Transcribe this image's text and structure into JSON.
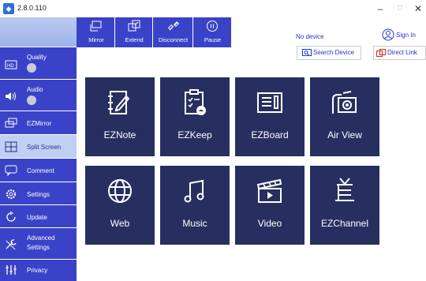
{
  "window": {
    "version": "2.8.0.110",
    "minimize": "–",
    "maximize": "□",
    "close": "✕"
  },
  "toolbar": {
    "mirror": "Mirror",
    "extend": "Extend",
    "disconnect": "Disconnect",
    "pause": "Pause"
  },
  "status": {
    "device": "No device"
  },
  "account": {
    "sign_in": "Sign In"
  },
  "links": {
    "search_device": "Search Device",
    "direct_link": "Direct Link"
  },
  "sidebar": {
    "items": [
      {
        "label": "Quality",
        "icon": "hd-icon"
      },
      {
        "label": "Audio",
        "icon": "speaker-icon"
      },
      {
        "label": "EZMirror",
        "icon": "ezmirror-icon"
      },
      {
        "label": "Split Screen",
        "icon": "split-screen-icon"
      },
      {
        "label": "Comment",
        "icon": "comment-icon"
      },
      {
        "label": "Settings",
        "icon": "gear-icon"
      },
      {
        "label": "Update",
        "icon": "update-icon"
      },
      {
        "label": "Advanced",
        "label2": "Settings",
        "icon": "wrench-icon"
      },
      {
        "label": "Privacy",
        "icon": "privacy-icon"
      }
    ],
    "active": "Split Screen"
  },
  "tiles": [
    {
      "label": "EZNote",
      "icon": "notebook-icon"
    },
    {
      "label": "EZKeep",
      "icon": "clipboard-icon"
    },
    {
      "label": "EZBoard",
      "icon": "whiteboard-icon"
    },
    {
      "label": "Air View",
      "icon": "camera-icon"
    },
    {
      "label": "Web",
      "icon": "globe-icon"
    },
    {
      "label": "Music",
      "icon": "music-icon"
    },
    {
      "label": "Video",
      "icon": "clapperboard-icon"
    },
    {
      "label": "EZChannel",
      "icon": "tv-icon"
    }
  ],
  "colors": {
    "accent": "#3a43c7",
    "tile": "#272f60",
    "link": "#2236c9",
    "active": "#bfd0f5"
  }
}
